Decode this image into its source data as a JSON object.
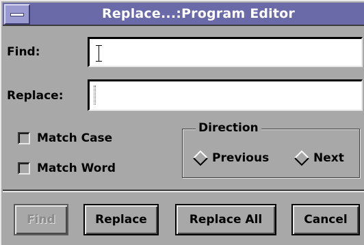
{
  "window": {
    "title": "Replace...:Program Editor",
    "colors": {
      "titlebar": "#6a6aa8",
      "face": "#a8a8a8"
    }
  },
  "find": {
    "label": "Find:",
    "value": ""
  },
  "replace": {
    "label": "Replace:",
    "value": ""
  },
  "options": {
    "match_case": {
      "label": "Match Case",
      "checked": false
    },
    "match_word": {
      "label": "Match Word",
      "checked": false
    }
  },
  "direction": {
    "title": "Direction",
    "previous_label": "Previous",
    "next_label": "Next",
    "selected": "none"
  },
  "buttons": {
    "find_label": "Find",
    "find_enabled": false,
    "replace_label": "Replace",
    "replace_all_label": "Replace All",
    "cancel_label": "Cancel"
  }
}
